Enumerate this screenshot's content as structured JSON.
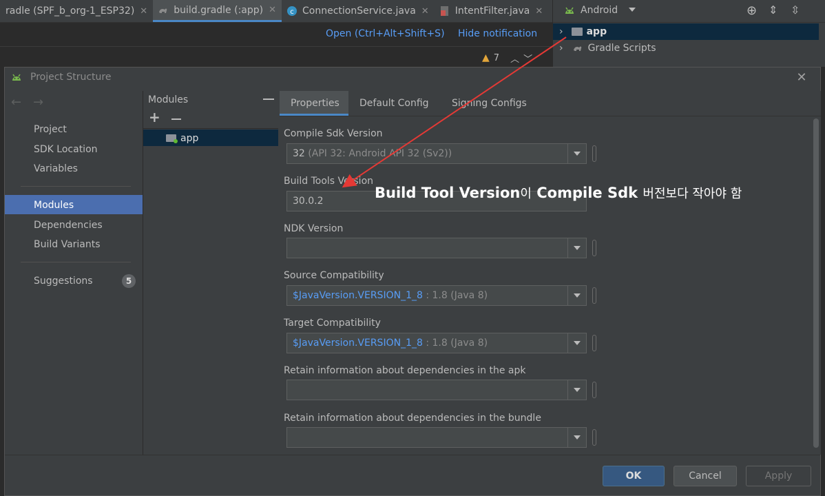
{
  "editor_tabs": [
    {
      "label": "radle (SPF_b_org-1_ESP32)",
      "icon": "gradle-icon",
      "active": false
    },
    {
      "label": "build.gradle (:app)",
      "icon": "gradle-icon",
      "active": true
    },
    {
      "label": "ConnectionService.java",
      "icon": "class-icon",
      "active": false
    },
    {
      "label": "IntentFilter.java",
      "icon": "java-file-icon",
      "active": false
    }
  ],
  "notification": {
    "open_link": "Open (Ctrl+Alt+Shift+S)",
    "hide_link": "Hide notification"
  },
  "inspections": {
    "warning_count": "7"
  },
  "project_panel": {
    "view": "Android",
    "items": [
      {
        "label": "app"
      },
      {
        "label": "Gradle Scripts"
      }
    ]
  },
  "dialog": {
    "title": "Project Structure",
    "nav": {
      "items": [
        "Project",
        "SDK Location",
        "Variables",
        "Modules",
        "Dependencies",
        "Build Variants",
        "Suggestions"
      ],
      "selected": "Modules",
      "suggestions_badge": "5"
    },
    "modules": {
      "header": "Modules",
      "items": [
        "app"
      ]
    },
    "tabs": [
      "Properties",
      "Default Config",
      "Signing Configs"
    ],
    "fields": {
      "compile_sdk": {
        "label": "Compile Sdk Version",
        "value": "32",
        "hint": "(API 32: Android API 32 (Sv2))"
      },
      "build_tools": {
        "label": "Build Tools Version",
        "value": "30.0.2"
      },
      "ndk": {
        "label": "NDK Version",
        "value": ""
      },
      "source_compat": {
        "label": "Source Compatibility",
        "value": "$JavaVersion.VERSION_1_8",
        "hint": ": 1.8 (Java 8)"
      },
      "target_compat": {
        "label": "Target Compatibility",
        "value": "$JavaVersion.VERSION_1_8",
        "hint": ": 1.8 (Java 8)"
      },
      "retain_apk": {
        "label": "Retain information about dependencies in the apk",
        "value": ""
      },
      "retain_bundle": {
        "label": "Retain information about dependencies in the bundle",
        "value": ""
      }
    },
    "buttons": {
      "ok": "OK",
      "cancel": "Cancel",
      "apply": "Apply"
    }
  },
  "annotation": {
    "main": "Build Tool Version",
    "josa": "이",
    "main2": "Compile Sdk",
    "tail": "버전보다 작아야 함",
    "color": "#e53935"
  },
  "colors": {
    "accent": "#4a88c7",
    "selection": "#4b6eaf",
    "link": "#589df6",
    "background": "#3c3f41"
  }
}
